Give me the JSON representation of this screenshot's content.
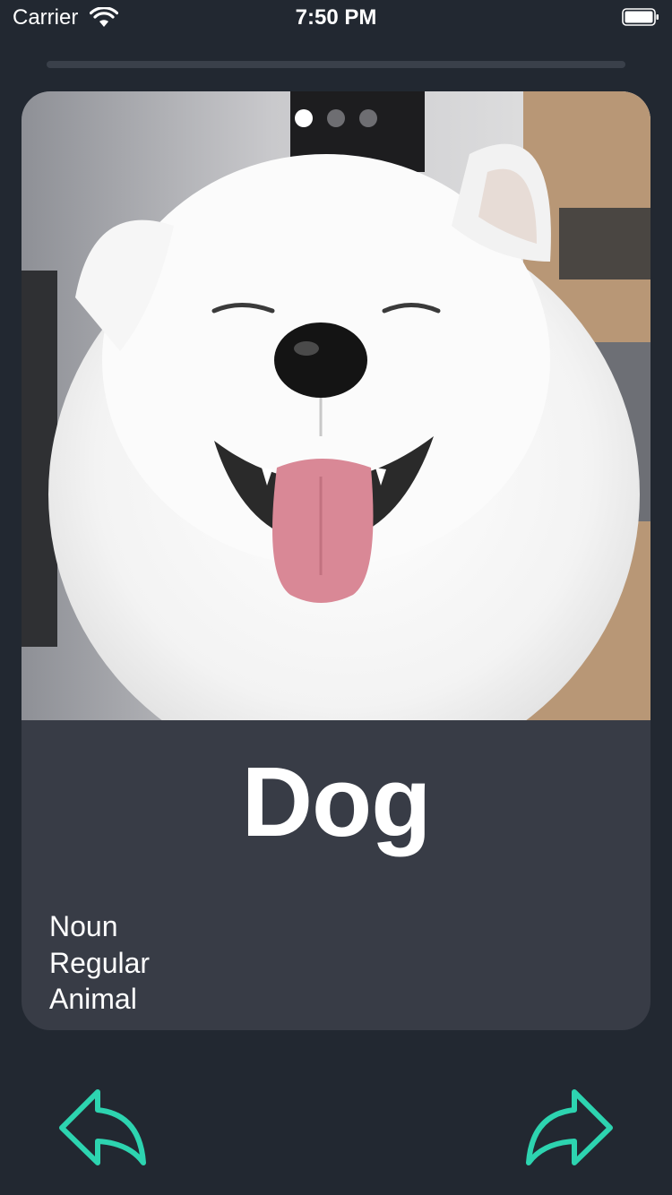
{
  "status_bar": {
    "carrier": "Carrier",
    "time": "7:50 PM"
  },
  "progress": {
    "fraction": 0.0
  },
  "card": {
    "image": {
      "subject": "white fluffy dog smiling",
      "icon": "photo-dog"
    },
    "pager": {
      "count": 3,
      "active_index": 0
    },
    "word": "Dog",
    "tags": [
      "Noun",
      "Regular",
      "Animal"
    ]
  },
  "nav": {
    "prev_icon": "reply-arrow-left-icon",
    "next_icon": "forward-arrow-right-icon"
  },
  "colors": {
    "background": "#222831",
    "card": "#383c46",
    "accent": "#2dd4b0",
    "text": "#ffffff"
  }
}
